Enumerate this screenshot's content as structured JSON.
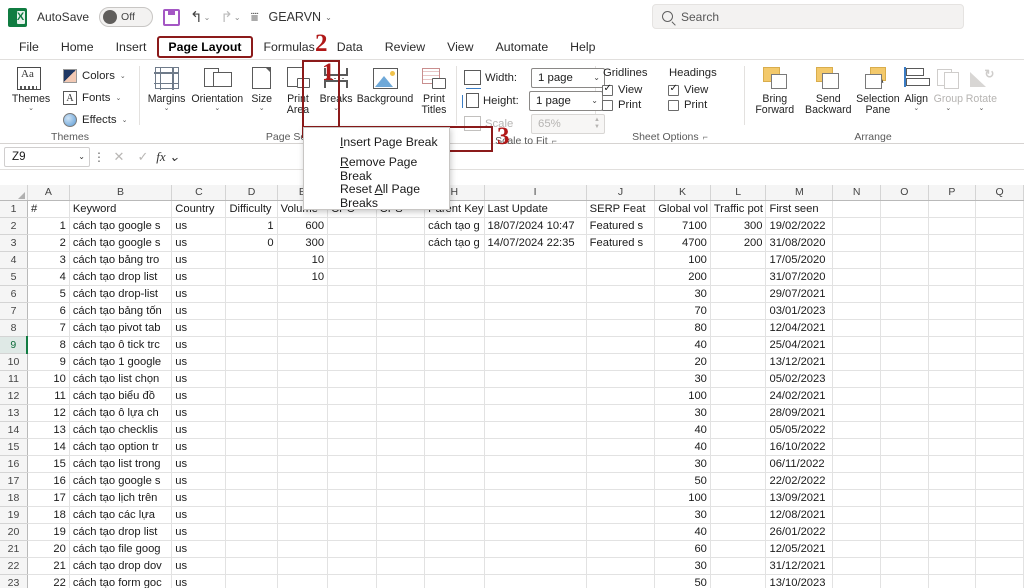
{
  "titlebar": {
    "app_icon": "excel-logo",
    "autosave_label": "AutoSave",
    "autosave_state": "Off",
    "save_icon": "save-icon",
    "undo_icon": "undo-icon",
    "redo_icon": "redo-icon",
    "qat_more_icon": "qat-more-icon",
    "document_name": "GEARVN",
    "search_placeholder": "Search",
    "search_icon": "search-icon"
  },
  "tabs": [
    {
      "label": "File",
      "active": false
    },
    {
      "label": "Home",
      "active": false
    },
    {
      "label": "Insert",
      "active": false
    },
    {
      "label": "Page Layout",
      "active": true
    },
    {
      "label": "Formulas",
      "active": false
    },
    {
      "label": "Data",
      "active": false
    },
    {
      "label": "Review",
      "active": false
    },
    {
      "label": "View",
      "active": false
    },
    {
      "label": "Automate",
      "active": false
    },
    {
      "label": "Help",
      "active": false
    }
  ],
  "ribbon": {
    "themes_group": {
      "label": "Themes",
      "themes_button": "Themes",
      "colors": "Colors",
      "fonts": "Fonts",
      "effects": "Effects"
    },
    "page_setup_group": {
      "label": "Page Setup",
      "buttons": [
        {
          "label": "Margins",
          "icon": "margins-icon"
        },
        {
          "label": "Orientation",
          "icon": "orientation-icon"
        },
        {
          "label": "Size",
          "icon": "size-icon"
        },
        {
          "label": "Print Area",
          "icon": "print-area-icon"
        },
        {
          "label": "Breaks",
          "icon": "breaks-icon"
        },
        {
          "label": "Background",
          "icon": "background-icon"
        },
        {
          "label": "Print Titles",
          "icon": "print-titles-icon"
        }
      ]
    },
    "scale_to_fit_group": {
      "label": "Scale to Fit",
      "width_label": "Width:",
      "width_value": "1 page",
      "height_label": "Height:",
      "height_value": "1 page",
      "scale_label": "Scale",
      "scale_value": "65%"
    },
    "sheet_options_group": {
      "label": "Sheet Options",
      "gridlines_header": "Gridlines",
      "headings_header": "Headings",
      "view_label": "View",
      "print_label": "Print",
      "gridlines_view_checked": true,
      "gridlines_print_checked": false,
      "headings_view_checked": true,
      "headings_print_checked": false
    },
    "arrange_group": {
      "label": "Arrange",
      "buttons": [
        {
          "label": "Bring Forward",
          "icon": "bring-forward-icon",
          "disabled": false
        },
        {
          "label": "Send Backward",
          "icon": "send-backward-icon",
          "disabled": false
        },
        {
          "label": "Selection Pane",
          "icon": "selection-pane-icon",
          "disabled": false
        },
        {
          "label": "Align",
          "icon": "align-icon",
          "disabled": false
        },
        {
          "label": "Group",
          "icon": "group-icon",
          "disabled": true
        },
        {
          "label": "Rotate",
          "icon": "rotate-icon",
          "disabled": true
        }
      ]
    }
  },
  "breaks_menu": {
    "items": [
      {
        "label": "Insert Page Break",
        "accel": "I",
        "highlighted": true
      },
      {
        "label": "Remove Page Break",
        "accel": "R",
        "highlighted": false
      },
      {
        "label": "Reset All Page Breaks",
        "accel": "A",
        "highlighted": false
      }
    ]
  },
  "annotations": [
    {
      "number": "1",
      "target": "page-setup-breaks"
    },
    {
      "number": "2",
      "target": "page-layout-tab"
    },
    {
      "number": "3",
      "target": "insert-page-break-item"
    }
  ],
  "formula_bar": {
    "name_box_value": "Z9",
    "cancel_icon": "cancel-icon",
    "enter_icon": "enter-icon",
    "fx_icon": "fx-icon",
    "formula_value": ""
  },
  "sheet": {
    "column_letters": [
      "A",
      "B",
      "C",
      "D",
      "E",
      "F",
      "G",
      "H",
      "I",
      "J",
      "K",
      "L",
      "M",
      "N",
      "O",
      "P",
      "Q"
    ],
    "row_numbers": [
      1,
      2,
      3,
      4,
      5,
      6,
      7,
      8,
      9,
      10,
      11,
      12,
      13,
      14,
      15,
      16,
      17,
      18,
      19,
      20,
      21,
      22,
      23
    ],
    "selected_row": 9,
    "headers": {
      "A": "#",
      "B": "Keyword",
      "C": "Country",
      "D": "Difficulty",
      "E": "Volume",
      "F": "CPC",
      "G": "CPS",
      "H": "Parent Key",
      "I": "Last Update",
      "J": "SERP Feat",
      "K": "Global vol",
      "L": "Traffic pot",
      "M": "First seen"
    },
    "rows": [
      {
        "n": "1",
        "keyword": "cách tạo google s",
        "country": "us",
        "difficulty": "1",
        "volume": "600",
        "parent": "cách tạo g",
        "last_update": "18/07/2024 10:47",
        "serp": "Featured s",
        "global_vol": "7100",
        "traffic_pot": "300",
        "first_seen": "19/02/2022"
      },
      {
        "n": "2",
        "keyword": "cách tạo google s",
        "country": "us",
        "difficulty": "0",
        "volume": "300",
        "parent": "cách tạo g",
        "last_update": "14/07/2024 22:35",
        "serp": "Featured s",
        "global_vol": "4700",
        "traffic_pot": "200",
        "first_seen": "31/08/2020"
      },
      {
        "n": "3",
        "keyword": "cách tạo bảng tro",
        "country": "us",
        "difficulty": "",
        "volume": "10",
        "parent": "",
        "last_update": "",
        "serp": "",
        "global_vol": "100",
        "traffic_pot": "",
        "first_seen": "17/05/2020"
      },
      {
        "n": "4",
        "keyword": "cách tạo drop list",
        "country": "us",
        "difficulty": "",
        "volume": "10",
        "parent": "",
        "last_update": "",
        "serp": "",
        "global_vol": "200",
        "traffic_pot": "",
        "first_seen": "31/07/2020"
      },
      {
        "n": "5",
        "keyword": "cách tạo drop-list",
        "country": "us",
        "difficulty": "",
        "volume": "",
        "parent": "",
        "last_update": "",
        "serp": "",
        "global_vol": "30",
        "traffic_pot": "",
        "first_seen": "29/07/2021"
      },
      {
        "n": "6",
        "keyword": "cách tạo bảng tốn",
        "country": "us",
        "difficulty": "",
        "volume": "",
        "parent": "",
        "last_update": "",
        "serp": "",
        "global_vol": "70",
        "traffic_pot": "",
        "first_seen": "03/01/2023"
      },
      {
        "n": "7",
        "keyword": "cách tạo pivot tab",
        "country": "us",
        "difficulty": "",
        "volume": "",
        "parent": "",
        "last_update": "",
        "serp": "",
        "global_vol": "80",
        "traffic_pot": "",
        "first_seen": "12/04/2021"
      },
      {
        "n": "8",
        "keyword": "cách tạo ô tick trc",
        "country": "us",
        "difficulty": "",
        "volume": "",
        "parent": "",
        "last_update": "",
        "serp": "",
        "global_vol": "40",
        "traffic_pot": "",
        "first_seen": "25/04/2021"
      },
      {
        "n": "9",
        "keyword": "cách tạo 1 google",
        "country": "us",
        "difficulty": "",
        "volume": "",
        "parent": "",
        "last_update": "",
        "serp": "",
        "global_vol": "20",
        "traffic_pot": "",
        "first_seen": "13/12/2021"
      },
      {
        "n": "10",
        "keyword": "cách tạo list chọn",
        "country": "us",
        "difficulty": "",
        "volume": "",
        "parent": "",
        "last_update": "",
        "serp": "",
        "global_vol": "30",
        "traffic_pot": "",
        "first_seen": "05/02/2023"
      },
      {
        "n": "11",
        "keyword": "cách tạo biểu đồ",
        "country": "us",
        "difficulty": "",
        "volume": "",
        "parent": "",
        "last_update": "",
        "serp": "",
        "global_vol": "100",
        "traffic_pot": "",
        "first_seen": "24/02/2021"
      },
      {
        "n": "12",
        "keyword": "cách tạo ô lựa ch",
        "country": "us",
        "difficulty": "",
        "volume": "",
        "parent": "",
        "last_update": "",
        "serp": "",
        "global_vol": "30",
        "traffic_pot": "",
        "first_seen": "28/09/2021"
      },
      {
        "n": "13",
        "keyword": "cách tạo checklis",
        "country": "us",
        "difficulty": "",
        "volume": "",
        "parent": "",
        "last_update": "",
        "serp": "",
        "global_vol": "40",
        "traffic_pot": "",
        "first_seen": "05/05/2022"
      },
      {
        "n": "14",
        "keyword": "cách tạo option tr",
        "country": "us",
        "difficulty": "",
        "volume": "",
        "parent": "",
        "last_update": "",
        "serp": "",
        "global_vol": "40",
        "traffic_pot": "",
        "first_seen": "16/10/2022"
      },
      {
        "n": "15",
        "keyword": "cách tạo list trong",
        "country": "us",
        "difficulty": "",
        "volume": "",
        "parent": "",
        "last_update": "",
        "serp": "",
        "global_vol": "30",
        "traffic_pot": "",
        "first_seen": "06/11/2022"
      },
      {
        "n": "16",
        "keyword": "cách tạo google s",
        "country": "us",
        "difficulty": "",
        "volume": "",
        "parent": "",
        "last_update": "",
        "serp": "",
        "global_vol": "50",
        "traffic_pot": "",
        "first_seen": "22/02/2022"
      },
      {
        "n": "17",
        "keyword": "cách tạo lịch trên",
        "country": "us",
        "difficulty": "",
        "volume": "",
        "parent": "",
        "last_update": "",
        "serp": "",
        "global_vol": "100",
        "traffic_pot": "",
        "first_seen": "13/09/2021"
      },
      {
        "n": "18",
        "keyword": "cách tạo các lựa",
        "country": "us",
        "difficulty": "",
        "volume": "",
        "parent": "",
        "last_update": "",
        "serp": "",
        "global_vol": "30",
        "traffic_pot": "",
        "first_seen": "12/08/2021"
      },
      {
        "n": "19",
        "keyword": "cách tạo drop list",
        "country": "us",
        "difficulty": "",
        "volume": "",
        "parent": "",
        "last_update": "",
        "serp": "",
        "global_vol": "40",
        "traffic_pot": "",
        "first_seen": "26/01/2022"
      },
      {
        "n": "20",
        "keyword": "cách tạo file goog",
        "country": "us",
        "difficulty": "",
        "volume": "",
        "parent": "",
        "last_update": "",
        "serp": "",
        "global_vol": "60",
        "traffic_pot": "",
        "first_seen": "12/05/2021"
      },
      {
        "n": "21",
        "keyword": "cách tạo drop dov",
        "country": "us",
        "difficulty": "",
        "volume": "",
        "parent": "",
        "last_update": "",
        "serp": "",
        "global_vol": "30",
        "traffic_pot": "",
        "first_seen": "31/12/2021"
      },
      {
        "n": "22",
        "keyword": "cách tạo form goc",
        "country": "us",
        "difficulty": "",
        "volume": "",
        "parent": "",
        "last_update": "",
        "serp": "",
        "global_vol": "50",
        "traffic_pot": "",
        "first_seen": "13/10/2023"
      }
    ]
  },
  "colors": {
    "annotation_red": "#8b1a1a",
    "annotation_number_red": "#b01818",
    "excel_green": "#107c41"
  }
}
